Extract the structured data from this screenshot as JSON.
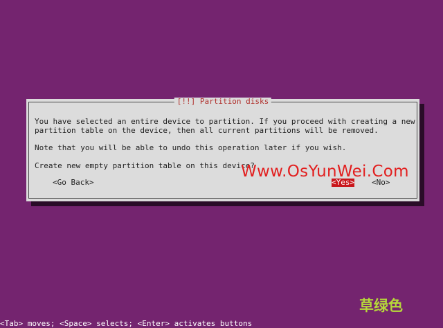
{
  "dialog": {
    "title": "[!!] Partition disks",
    "message_lines": [
      "You have selected an entire device to partition. If you proceed with creating a new",
      "partition table on the device, then all current partitions will be removed.",
      "",
      "Note that you will be able to undo this operation later if you wish.",
      "",
      "Create new empty partition table on this device?"
    ],
    "buttons": {
      "go_back": "<Go Back>",
      "yes": "<Yes>",
      "no": "<No>"
    },
    "selected_button": "yes"
  },
  "watermark": "Www.OsYunWei.Com",
  "corner_mark": "草绿色",
  "statusbar": "<Tab> moves; <Space> selects; <Enter> activates buttons",
  "colors": {
    "background": "#74246f",
    "dialog": "#dcdcdc",
    "title": "#b0302c",
    "selected_button": "#c9161b",
    "watermark": "#e21f1f",
    "corner_mark": "#b6d93a"
  }
}
